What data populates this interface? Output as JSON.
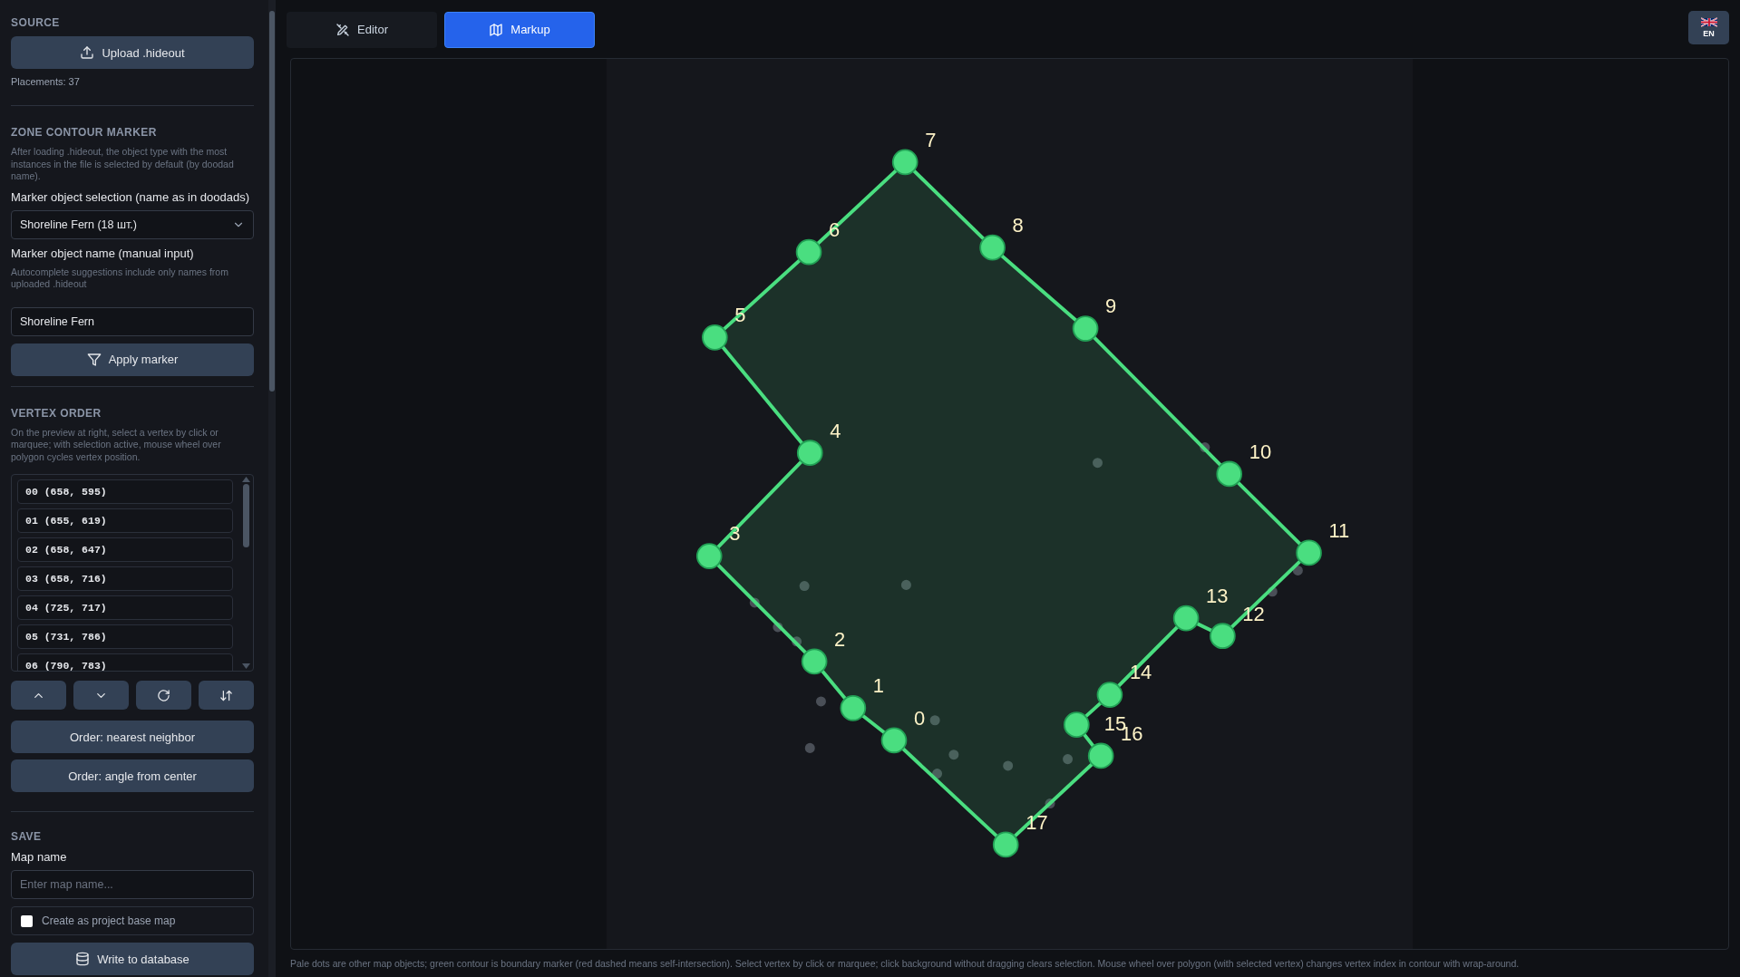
{
  "tabs": [
    {
      "label": "Editor",
      "selected": false
    },
    {
      "label": "Markup",
      "selected": true
    }
  ],
  "language": {
    "code": "EN"
  },
  "source": {
    "heading": "SOURCE",
    "upload_button": "Upload .hideout",
    "placements": "Placements: 37"
  },
  "zone_marker": {
    "heading": "ZONE CONTOUR MARKER",
    "hint": "After loading .hideout, the object type with the most instances in the file is selected by default (by doodad name).",
    "select_label": "Marker object selection (name as in doodads)",
    "select_value": "Shoreline Fern (18 шт.)",
    "name_label": "Marker object name (manual input)",
    "name_hint": "Autocomplete suggestions include only names from uploaded .hideout",
    "name_value": "Shoreline Fern",
    "apply_button": "Apply marker"
  },
  "vertex_order": {
    "heading": "VERTEX ORDER",
    "hint": "On the preview at right, select a vertex by click or marquee; with selection active, mouse wheel over polygon cycles vertex position.",
    "vertices": [
      "00 (658, 595)",
      "01 (655, 619)",
      "02 (658, 647)",
      "03 (658, 716)",
      "04 (725, 717)",
      "05 (731, 786)",
      "06 (790, 783)"
    ],
    "order_buttons": [
      "Order: nearest neighbor",
      "Order: angle from center"
    ]
  },
  "save": {
    "heading": "SAVE",
    "map_name_label": "Map name",
    "map_name_placeholder": "Enter map name...",
    "base_map": {
      "label": "Create as project base map",
      "checked": false
    },
    "write_button": "Write to database"
  },
  "canvas": {
    "vertex_labels": [
      "0",
      "1",
      "2",
      "3",
      "4",
      "5",
      "6",
      "7",
      "8",
      "9",
      "10",
      "11",
      "12",
      "13",
      "14",
      "15",
      "16",
      "17"
    ]
  },
  "caption": "Pale dots are other map objects; green contour is boundary marker (red dashed means self-intersection). Select vertex by click or marquee; click background without dragging clears selection. Mouse wheel over polygon (with selected vertex) changes vertex index in contour with wrap-around."
}
